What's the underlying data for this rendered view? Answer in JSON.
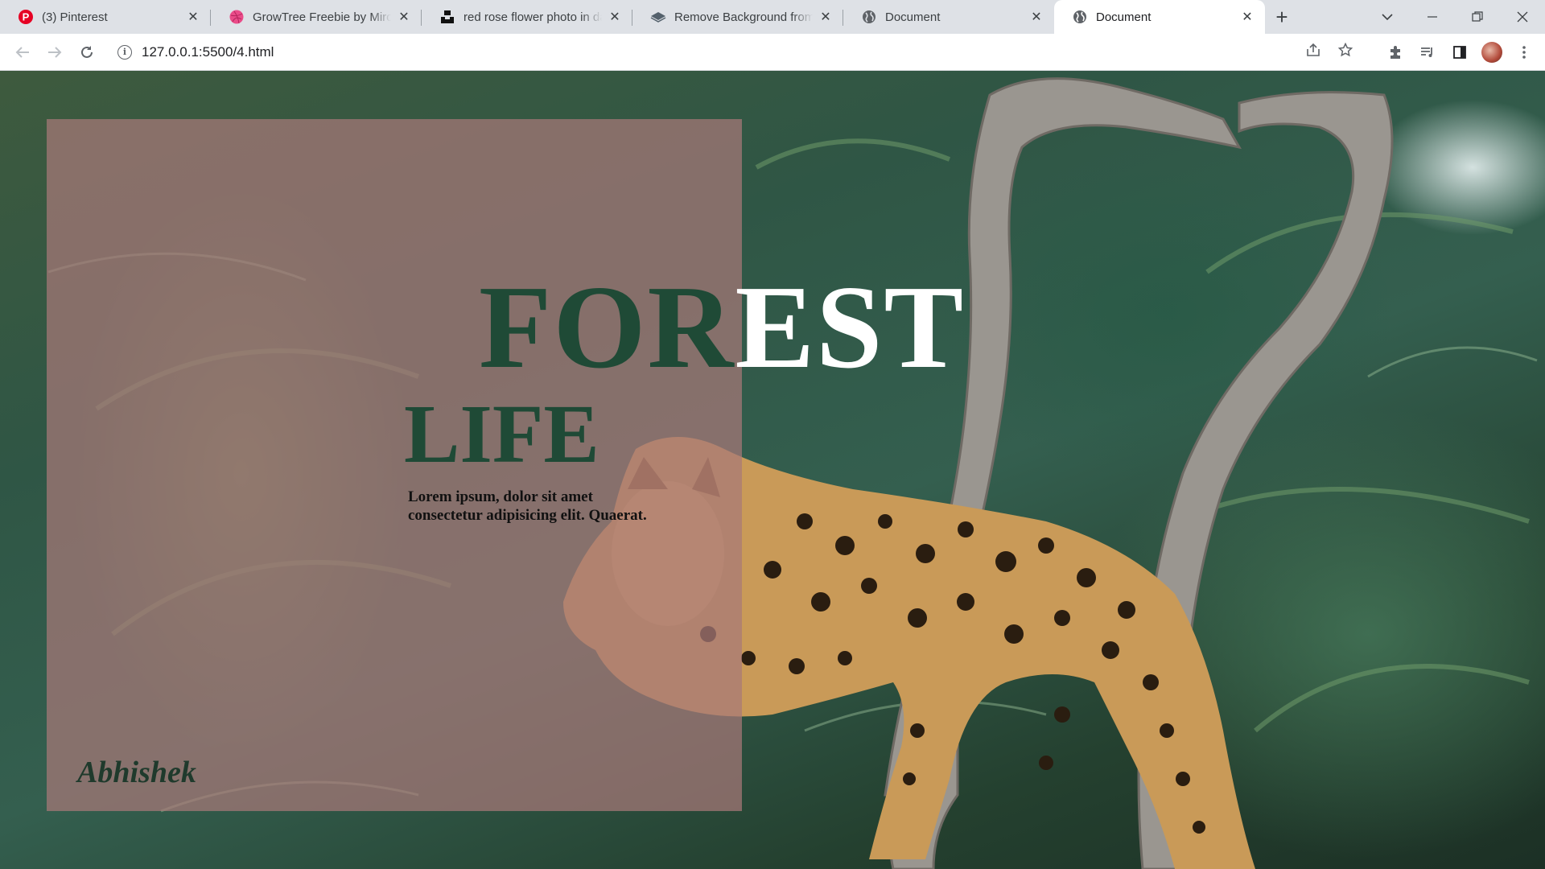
{
  "browser": {
    "tabs": [
      {
        "title": "(3) Pinterest",
        "icon": "pinterest-icon",
        "active": false
      },
      {
        "title": "GrowTree Freebie by Miro / Dribbble",
        "icon": "dribbble-icon",
        "active": false
      },
      {
        "title": "red rose flower photo in dark background",
        "icon": "unsplash-icon",
        "active": false
      },
      {
        "title": "Remove Background from Image",
        "icon": "removebg-icon",
        "active": false
      },
      {
        "title": "Document",
        "icon": "globe-icon",
        "active": false
      },
      {
        "title": "Document",
        "icon": "globe-icon",
        "active": true
      }
    ],
    "url": "127.0.0.1:5500/4.html"
  },
  "page": {
    "heading_main": "FOREST",
    "heading_main_overlay_part": "FOR",
    "heading_main_rest": "EST",
    "heading_sub": "LIFE",
    "tagline": "Lorem ipsum, dolor sit amet consectetur adipisicing elit. Quaerat.",
    "signature": "Abhishek"
  },
  "colors": {
    "panel": "#a87878",
    "heading_dark": "#1f4a36",
    "heading_light": "#ffffff",
    "tab_strip": "#dee1e6"
  }
}
